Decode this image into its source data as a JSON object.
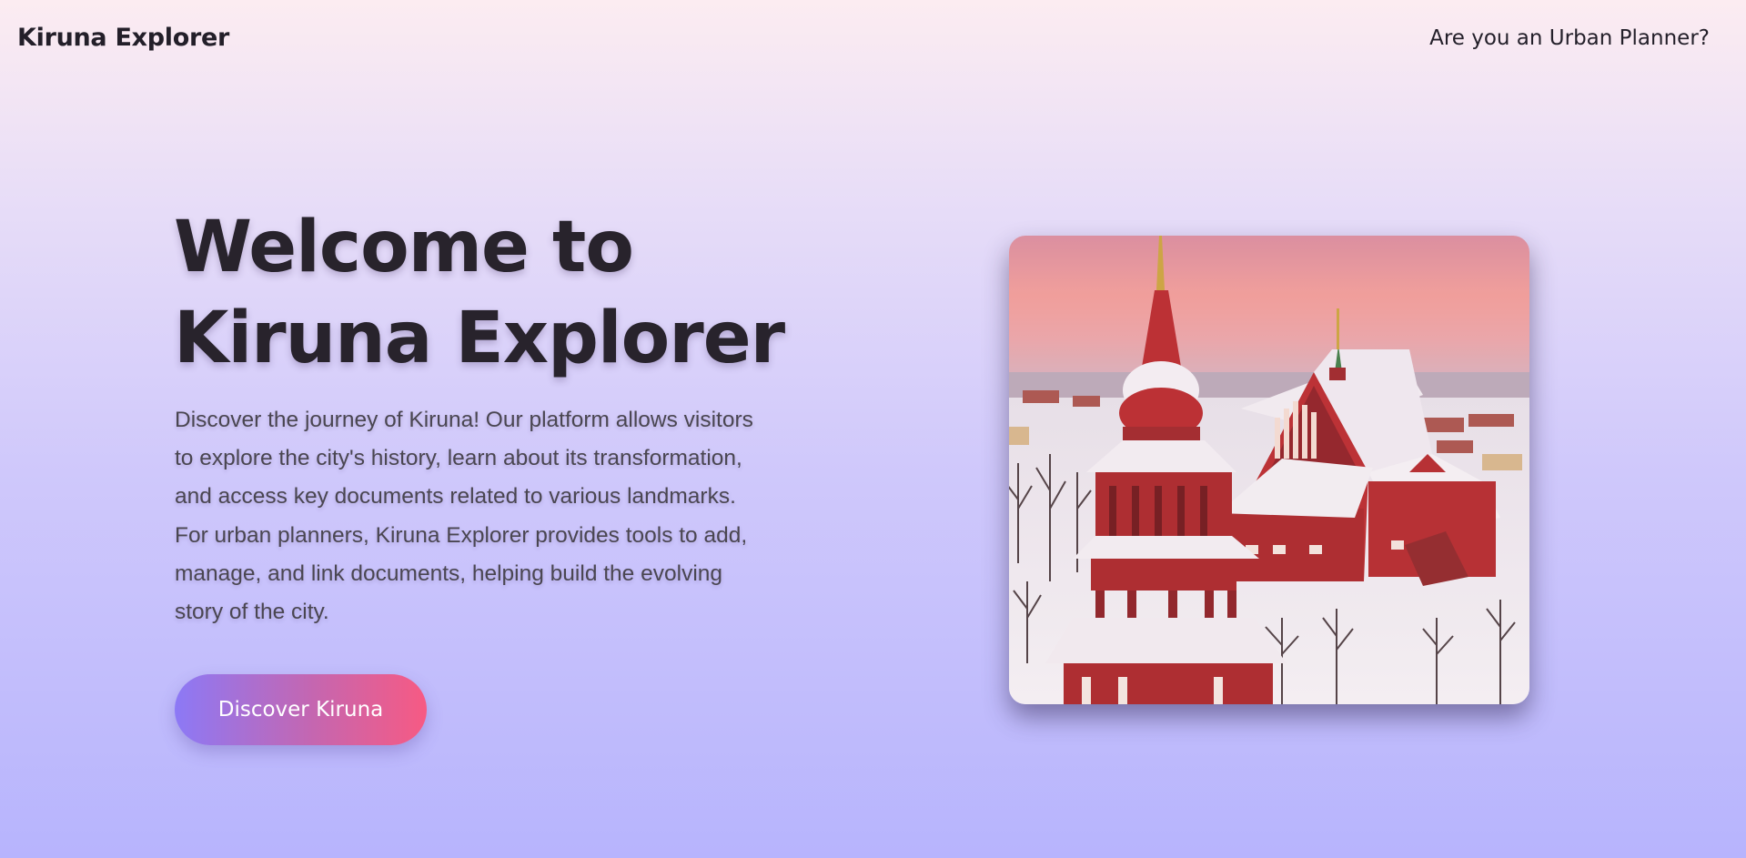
{
  "header": {
    "brand": "Kiruna Explorer",
    "planner_link": "Are you an Urban Planner?"
  },
  "hero": {
    "title_line1": "Welcome to",
    "title_line2": "Kiruna Explorer",
    "description": "Discover the journey of Kiruna! Our platform allows visitors to explore the city's history, learn about its transformation, and access key documents related to various landmarks. For urban planners, Kiruna Explorer provides tools to add, manage, and link documents, helping build the evolving story of the city.",
    "cta_label": "Discover Kiruna"
  },
  "colors": {
    "bg_top": "#fcecf1",
    "bg_bottom": "#b7b4fd",
    "cta_start": "#8c79f6",
    "cta_end": "#f75a83",
    "text": "#27232b"
  }
}
